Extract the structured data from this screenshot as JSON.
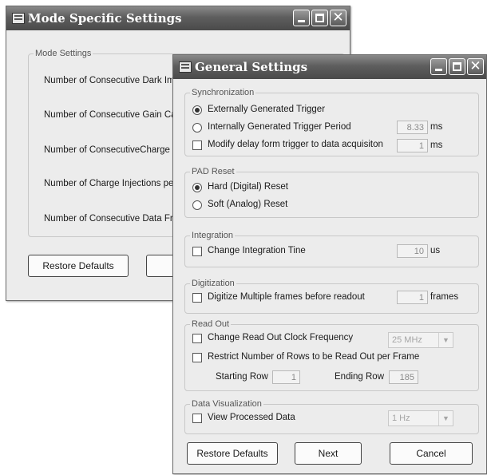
{
  "mode_window": {
    "title": "Mode Specific Settings",
    "group_label": "Mode Settings",
    "rows": [
      "Number of Consecutive Dark Ima",
      "Number of Consecutive Gain Calib",
      "Number of ConsecutiveCharge Inj",
      "Number of Charge Injections per F",
      "Number of Consecutive Data Fram"
    ],
    "restore_label": "Restore Defaults"
  },
  "general_window": {
    "title": "General Settings",
    "sync": {
      "label": "Synchronization",
      "external": "Externally Generated Trigger",
      "internal": "Internally Generated Trigger Period",
      "internal_value": "8.33",
      "internal_unit": "ms",
      "delay": "Modify delay form trigger to data acquisiton",
      "delay_value": "1",
      "delay_unit": "ms"
    },
    "pad": {
      "label": "PAD Reset",
      "hard": "Hard (Digital) Reset",
      "soft": "Soft (Analog) Reset"
    },
    "integration": {
      "label": "Integration",
      "change": "Change Integration Tine",
      "value": "10",
      "unit": "us"
    },
    "digitization": {
      "label": "Digitization",
      "multi": "Digitize Multiple frames before readout",
      "value": "1",
      "unit": "frames"
    },
    "readout": {
      "label": "Read Out",
      "clock": "Change Read Out Clock Frequency",
      "clock_value": "25 MHz",
      "restrict": "Restrict Number of Rows to be Read Out per Frame",
      "start_label": "Starting Row",
      "start_value": "1",
      "end_label": "Ending Row",
      "end_value": "185"
    },
    "visualization": {
      "label": "Data Visualization",
      "view": "View Processed Data",
      "rate_value": "1 Hz"
    },
    "buttons": {
      "restore": "Restore Defaults",
      "next": "Next",
      "cancel": "Cancel"
    }
  },
  "icons": [
    "window-icon",
    "minimize-icon",
    "maximize-icon",
    "close-icon",
    "dropdown-arrow-icon"
  ]
}
